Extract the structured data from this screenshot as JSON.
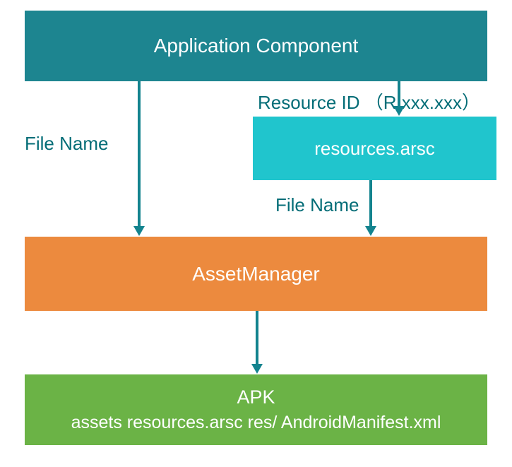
{
  "boxes": {
    "appComponent": "Application Component",
    "resources": "resources.arsc",
    "assetManager": "AssetManager",
    "apkTitle": "APK",
    "apkSubtitle": "assets resources.arsc res/ AndroidManifest.xml"
  },
  "labels": {
    "fileNameLeft": "File Name",
    "resourceId": "Resource ID （R.xxx.xxx）",
    "fileNameRight": "File Name"
  }
}
